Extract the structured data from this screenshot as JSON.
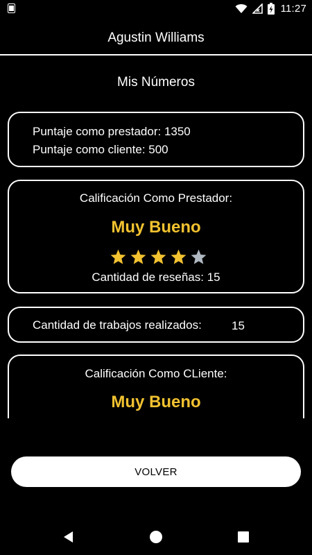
{
  "status_bar": {
    "time": "11:27",
    "icons": [
      "sim-card-icon",
      "wifi-icon",
      "no-signal-icon",
      "battery-charging-icon"
    ]
  },
  "header": {
    "title": "Agustin Williams"
  },
  "section": {
    "title": "Mis Números"
  },
  "scores": {
    "provider_score": "Puntaje como prestador: 1350",
    "client_score": "Puntaje como cliente: 500"
  },
  "provider_rating": {
    "label": "Calificación Como Prestador:",
    "value": "Muy Bueno",
    "stars_filled": 4,
    "stars_total": 5,
    "reviews": "Cantidad de reseñas: 15"
  },
  "jobs": {
    "label": "Cantidad de trabajos realizados:",
    "value": "15"
  },
  "client_rating": {
    "label": "Calificación Como CLiente:",
    "value": "Muy Bueno"
  },
  "actions": {
    "back_label": "VOLVER"
  },
  "nav": {
    "icons": [
      "back-icon",
      "home-icon",
      "recents-icon"
    ]
  },
  "colors": {
    "background": "#000000",
    "foreground": "#ffffff",
    "accent": "#f2c230",
    "star_empty": "#b0b8c1"
  }
}
